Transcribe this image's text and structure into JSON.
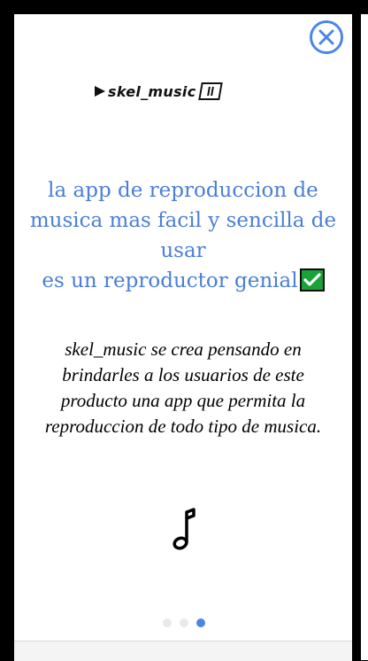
{
  "logo": {
    "text": "skel_music"
  },
  "headline": {
    "line1": "la app de reproduccion de",
    "line2": "musica mas facil y sencilla de",
    "line3": "usar",
    "line4": "es un reproductor genial"
  },
  "description": {
    "text": "skel_music se crea pensando en brindarles a los usuarios de este producto una app que permita la reproduccion de todo tipo de musica."
  },
  "pagination": {
    "count": 3,
    "active_index": 2
  },
  "colors": {
    "accent": "#4a86e8",
    "headline": "#4a7fd6",
    "check_green": "#1aa23a"
  },
  "icons": {
    "close": "close-icon",
    "logo_play": "play-icon",
    "logo_pause": "pause-icon",
    "check": "check-mark-icon",
    "music": "music-note-icon"
  }
}
